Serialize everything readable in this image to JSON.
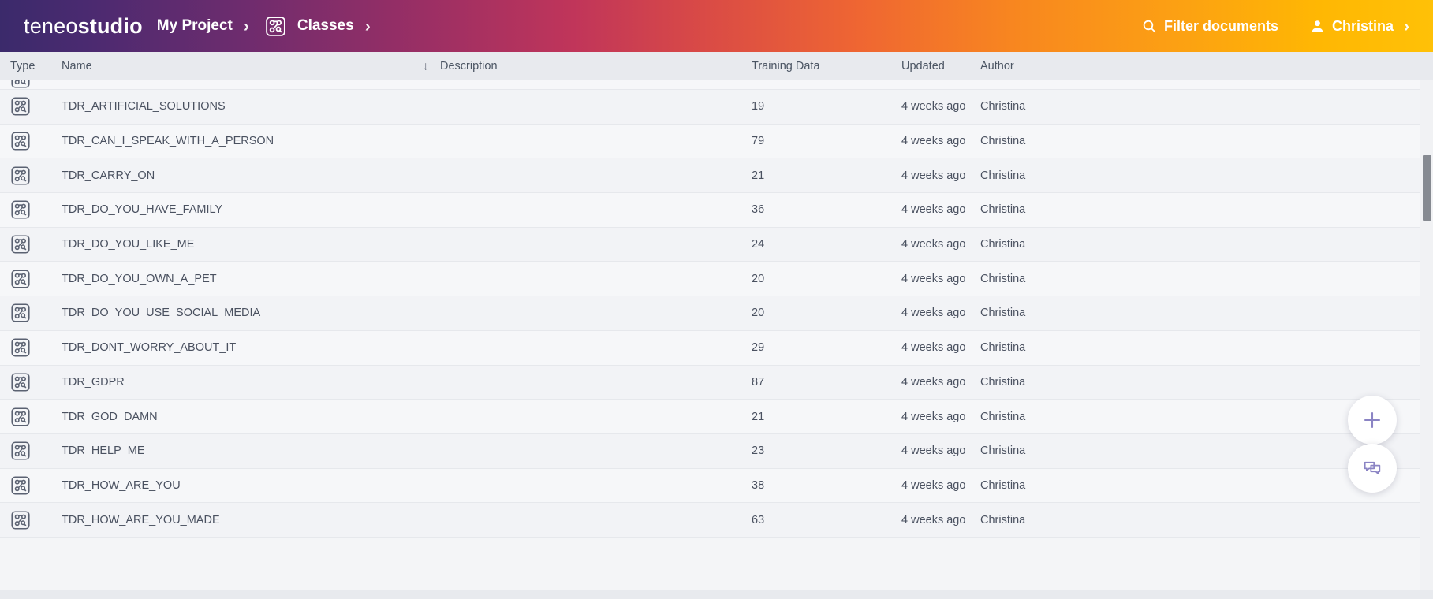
{
  "header": {
    "brand_light": "teneo",
    "brand_bold": "studio",
    "project": "My Project",
    "separator": "›",
    "section": "Classes",
    "classes_icon": "classes-graph-icon",
    "filter_label": "Filter documents",
    "filter_icon": "search-icon",
    "user_name": "Christina",
    "user_icon": "person-icon",
    "user_chevron": "›",
    "gradient_start": "#3b2a6b",
    "gradient_mid": "#d94a46",
    "gradient_end": "#ffc107"
  },
  "table": {
    "columns": [
      {
        "key": "type",
        "label": "Type"
      },
      {
        "key": "name",
        "label": "Name"
      },
      {
        "key": "desc",
        "label": "Description"
      },
      {
        "key": "training",
        "label": "Training Data"
      },
      {
        "key": "updated",
        "label": "Updated"
      },
      {
        "key": "author",
        "label": "Author"
      }
    ],
    "sort": {
      "column": "Name",
      "direction": "descending",
      "glyph": "↓"
    },
    "row_icon": "class-graph-icon",
    "rows": [
      {
        "name": "TDR_ARTIFICIAL_SOLUTIONS",
        "desc": "",
        "training": "19",
        "updated": "4 weeks ago",
        "author": "Christina"
      },
      {
        "name": "TDR_CAN_I_SPEAK_WITH_A_PERSON",
        "desc": "",
        "training": "79",
        "updated": "4 weeks ago",
        "author": "Christina"
      },
      {
        "name": "TDR_CARRY_ON",
        "desc": "",
        "training": "21",
        "updated": "4 weeks ago",
        "author": "Christina"
      },
      {
        "name": "TDR_DO_YOU_HAVE_FAMILY",
        "desc": "",
        "training": "36",
        "updated": "4 weeks ago",
        "author": "Christina"
      },
      {
        "name": "TDR_DO_YOU_LIKE_ME",
        "desc": "",
        "training": "24",
        "updated": "4 weeks ago",
        "author": "Christina"
      },
      {
        "name": "TDR_DO_YOU_OWN_A_PET",
        "desc": "",
        "training": "20",
        "updated": "4 weeks ago",
        "author": "Christina"
      },
      {
        "name": "TDR_DO_YOU_USE_SOCIAL_MEDIA",
        "desc": "",
        "training": "20",
        "updated": "4 weeks ago",
        "author": "Christina"
      },
      {
        "name": "TDR_DONT_WORRY_ABOUT_IT",
        "desc": "",
        "training": "29",
        "updated": "4 weeks ago",
        "author": "Christina"
      },
      {
        "name": "TDR_GDPR",
        "desc": "",
        "training": "87",
        "updated": "4 weeks ago",
        "author": "Christina"
      },
      {
        "name": "TDR_GOD_DAMN",
        "desc": "",
        "training": "21",
        "updated": "4 weeks ago",
        "author": "Christina"
      },
      {
        "name": "TDR_HELP_ME",
        "desc": "",
        "training": "23",
        "updated": "4 weeks ago",
        "author": "Christina"
      },
      {
        "name": "TDR_HOW_ARE_YOU",
        "desc": "",
        "training": "38",
        "updated": "4 weeks ago",
        "author": "Christina"
      },
      {
        "name": "TDR_HOW_ARE_YOU_MADE",
        "desc": "",
        "training": "63",
        "updated": "4 weeks ago",
        "author": "Christina"
      }
    ]
  },
  "fab": {
    "add_icon": "plus-icon",
    "add_label": "Add",
    "chat_icon": "chat-bubbles-icon",
    "chat_label": "Chat",
    "accent": "#8b84c4"
  },
  "scrollbar": {
    "orientation": "vertical",
    "thumb_color": "#868a91"
  }
}
